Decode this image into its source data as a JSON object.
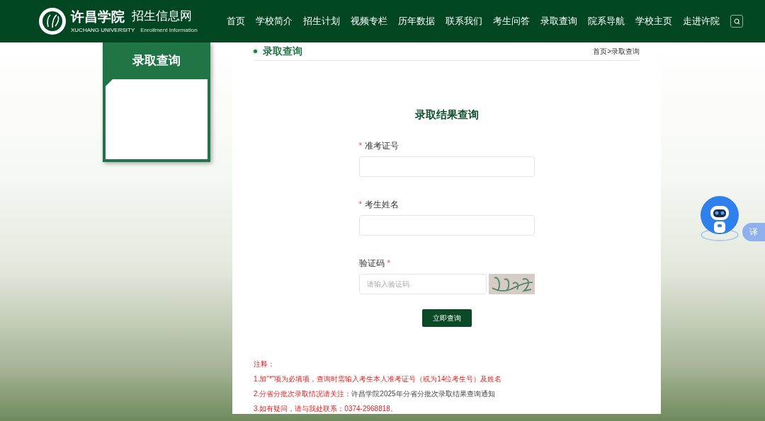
{
  "header": {
    "logo_title": "许昌学院",
    "logo_subtitle": "XUCHANG UNIVERSITY",
    "site_title": "招生信息网",
    "site_subtitle": "Enrollment Information",
    "nav": [
      {
        "label": "首页",
        "selected": false
      },
      {
        "label": "学校简介",
        "selected": false
      },
      {
        "label": "招生计划",
        "selected": false
      },
      {
        "label": "视频专栏",
        "selected": false
      },
      {
        "label": "历年数据",
        "selected": false
      },
      {
        "label": "联系我们",
        "selected": false
      },
      {
        "label": "考生问答",
        "selected": false
      },
      {
        "label": "录取查询",
        "selected": false
      },
      {
        "label": "院系导航",
        "selected": false
      },
      {
        "label": "学校主页",
        "selected": false
      },
      {
        "label": "走进许院",
        "selected": false
      }
    ]
  },
  "sidebar": {
    "title": "录取查询"
  },
  "page": {
    "title": "录取查询",
    "breadcrumb": "首页>录取查询"
  },
  "form": {
    "title": "录取结果查询",
    "fields": [
      {
        "kind": "text",
        "mark_prefix": "*",
        "label": "准考证号"
      },
      {
        "kind": "text",
        "mark_prefix": "*",
        "label": "考生姓名"
      },
      {
        "kind": "captcha",
        "label": "验证码",
        "mark_suffix": "*",
        "placeholder": "请输入验证码"
      }
    ],
    "submit": "立即查询"
  },
  "notes": {
    "title": "注释：",
    "items": [
      {
        "text": "1.加\"*\"项为必填项，查询时需输入考生本人准考证号（或为14位考生号）及姓名"
      },
      {
        "text": "2.分省分批次录取情况请关注：",
        "link": "许昌学院2025年分省分批次录取结果查询通知"
      },
      {
        "text": "3.如有疑问，请与我处联系：0374-2968818。"
      }
    ]
  },
  "widget": {
    "translate": "译"
  }
}
